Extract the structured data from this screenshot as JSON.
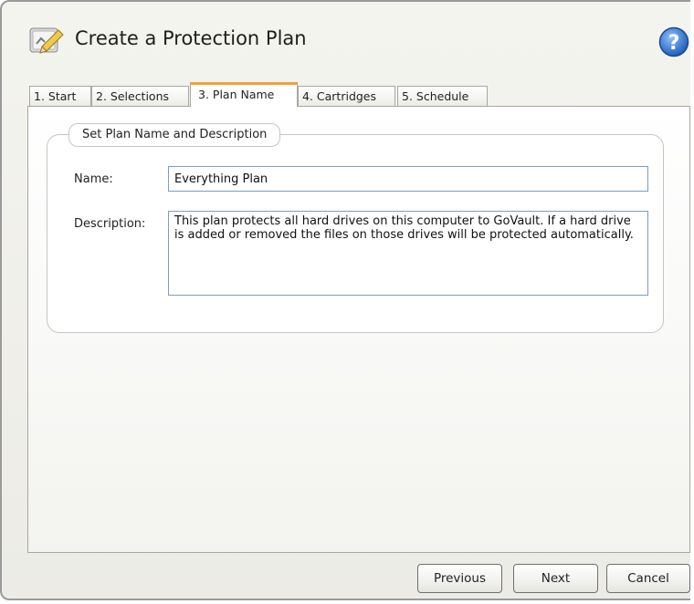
{
  "window": {
    "title": "Create a Protection Plan"
  },
  "tabs": [
    {
      "label": "1. Start"
    },
    {
      "label": "2. Selections"
    },
    {
      "label": "3. Plan Name"
    },
    {
      "label": "4. Cartridges"
    },
    {
      "label": "5. Schedule"
    }
  ],
  "active_tab": "3. Plan Name",
  "group": {
    "legend": "Set Plan Name and Description"
  },
  "form": {
    "name_label": "Name:",
    "name_value": "Everything Plan",
    "description_label": "Description:",
    "description_value": "This plan protects all hard drives on this computer to GoVault. If a hard drive is added or removed the files on those drives will be protected automatically."
  },
  "buttons": {
    "previous": "Previous",
    "next": "Next",
    "cancel": "Cancel"
  },
  "icons": {
    "title": "wizard-pencil-icon",
    "help": "help-icon"
  },
  "colors": {
    "active_tab_accent": "#f0a23a",
    "help_icon": "#2f6fc4",
    "input_border": "#7f9db9"
  }
}
